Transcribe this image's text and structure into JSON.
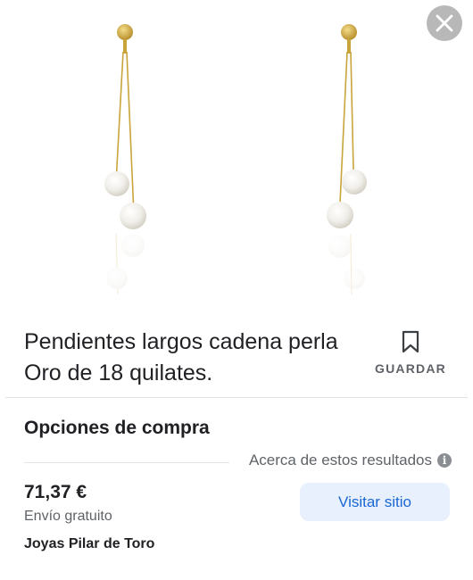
{
  "product": {
    "title": "Pendientes largos cadena perla Oro de 18 quilates.",
    "image_icon": "earrings-product-image"
  },
  "actions": {
    "save_label": "GUARDAR",
    "close_icon": "close-icon"
  },
  "purchase": {
    "section_title": "Opciones de compra",
    "about_results": "Acerca de estos resultados",
    "price": "71,37 €",
    "shipping": "Envío gratuito",
    "seller": "Joyas Pilar de Toro",
    "visit_label": "Visitar sitio"
  },
  "colors": {
    "accent": "#1967d2",
    "button_bg": "#e8f0fe",
    "gold": "#c9a43a"
  }
}
